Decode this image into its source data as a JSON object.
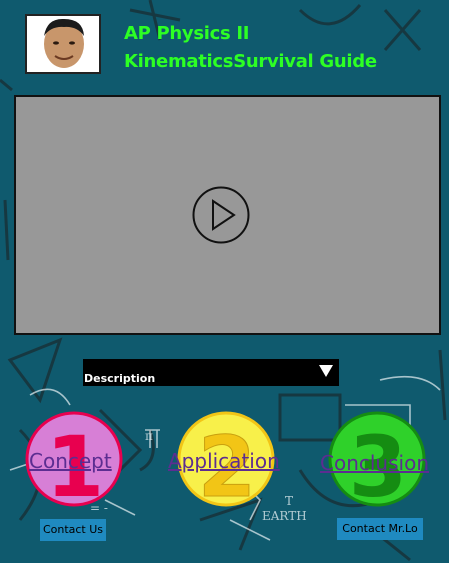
{
  "header": {
    "title_line1": "AP Physics II",
    "title_line2": "KinematicsSurvival Guide",
    "title_color": "#2dff24"
  },
  "video": {
    "icon": "play-icon"
  },
  "description": {
    "label": "Description",
    "icon": "triangle-down-icon"
  },
  "sections": [
    {
      "number": "1",
      "label": "Concept",
      "fill": "#d77fd6",
      "numeral_color": "#e8004f"
    },
    {
      "number": "2",
      "label": "Application",
      "fill": "#f8f04a",
      "numeral_color": "#f2c516"
    },
    {
      "number": "3",
      "label": "Conclusion",
      "fill": "#2fd12a",
      "numeral_color": "#158c12"
    }
  ],
  "contacts": {
    "contact_us": "Contact Us",
    "contact_teacher": "Contact Mr.Lo"
  },
  "colors": {
    "background": "#0f5a6e",
    "contact_button": "#1f8ac0",
    "link_text": "#5c2d91"
  }
}
